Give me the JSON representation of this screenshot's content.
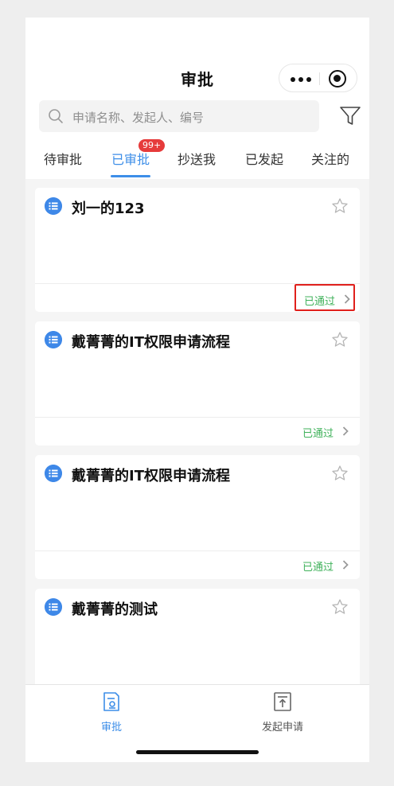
{
  "nav": {
    "title": "审批"
  },
  "search": {
    "placeholder": "申请名称、发起人、编号"
  },
  "tabs": [
    {
      "label": "待审批",
      "active": false
    },
    {
      "label": "已审批",
      "active": true,
      "badge": "99+"
    },
    {
      "label": "抄送我",
      "active": false
    },
    {
      "label": "已发起",
      "active": false
    },
    {
      "label": "关注的",
      "active": false
    }
  ],
  "cards": [
    {
      "title": "刘一的123",
      "status": "已通过",
      "highlighted": true
    },
    {
      "title": "戴菁菁的IT权限申请流程",
      "status": "已通过",
      "highlighted": false
    },
    {
      "title": "戴菁菁的IT权限申请流程",
      "status": "已通过",
      "highlighted": false
    },
    {
      "title": "戴菁菁的测试",
      "status": "",
      "highlighted": false
    }
  ],
  "tabbar": [
    {
      "label": "审批",
      "active": true
    },
    {
      "label": "发起申请",
      "active": false
    }
  ],
  "colors": {
    "accent": "#3d8ee8",
    "approved": "#3fb15a",
    "badge": "#e63b3b",
    "highlight": "#e0201c"
  }
}
